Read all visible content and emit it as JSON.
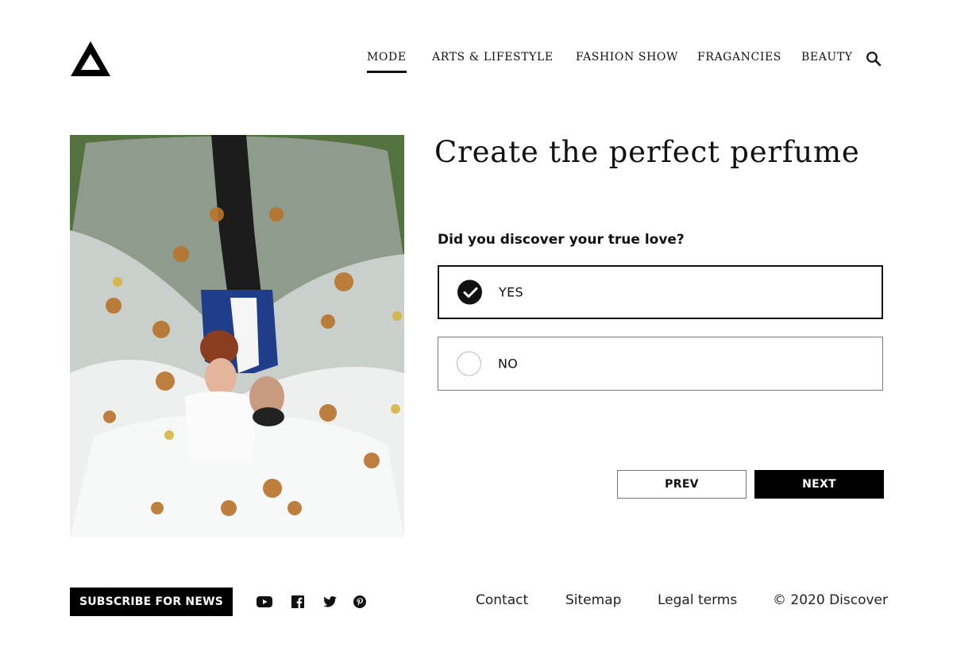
{
  "header": {
    "logo_name": "triangle-logo",
    "nav": [
      {
        "label": "MODE",
        "active": true
      },
      {
        "label": "ARTS & LIFESTYLE",
        "active": false
      },
      {
        "label": "FASHION SHOW",
        "active": false
      },
      {
        "label": "FRAGANCIES",
        "active": false
      },
      {
        "label": "BEAUTY",
        "active": false
      }
    ],
    "search_icon": "search-icon"
  },
  "hero": {
    "image_description": "Wedding couple lying on a veil among autumn leaves"
  },
  "form": {
    "title": "Create the perfect perfume",
    "question": "Did you discover your true love?",
    "options": [
      {
        "label": "YES",
        "selected": true
      },
      {
        "label": "NO",
        "selected": false
      }
    ],
    "prev_label": "PREV",
    "next_label": "NEXT"
  },
  "footer": {
    "subscribe_label": "SUBSCRIBE FOR NEWS",
    "social": [
      "youtube-icon",
      "facebook-icon",
      "twitter-icon",
      "pinterest-icon"
    ],
    "links": [
      "Contact",
      "Sitemap",
      "Legal terms"
    ],
    "copyright": "© 2020 Discover"
  },
  "colors": {
    "primary": "#000000",
    "background": "#ffffff",
    "border": "#777777"
  }
}
